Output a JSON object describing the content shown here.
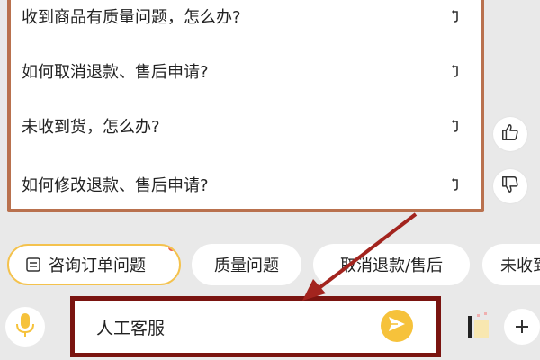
{
  "faq": {
    "items": [
      {
        "label": "收到商品有质量问题，怎么办?"
      },
      {
        "label": "如何取消退款、售后申请?"
      },
      {
        "label": "未收到货，怎么办?"
      },
      {
        "label": "如何修改退款、售后申请?"
      }
    ],
    "arrow_icon": "return-arrow-icon"
  },
  "feedback": {
    "like_icon": "thumbs-up-icon",
    "dislike_icon": "thumbs-down-icon"
  },
  "chips": [
    {
      "label": "咨询订单问题",
      "icon": "order-icon",
      "has_badge": true
    },
    {
      "label": "质量问题"
    },
    {
      "label": "取消退款/售后"
    },
    {
      "label": "未收到"
    }
  ],
  "composer": {
    "mic_icon": "microphone-icon",
    "input_value": "人工客服",
    "send_icon": "send-icon",
    "accent_color": "#f6c23b",
    "highlight_color": "#7a1410"
  }
}
